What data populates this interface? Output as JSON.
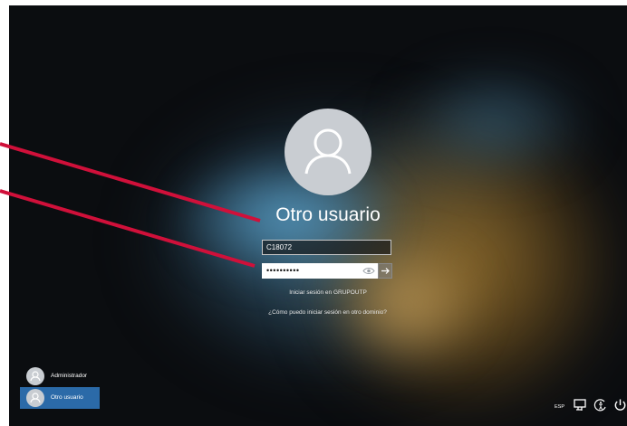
{
  "login": {
    "user_title": "Otro usuario",
    "username_value": "C18072",
    "password_mask": "••••••••••",
    "signin_domain_text": "Iniciar sesión en GRUPOUTP",
    "help_link": "¿Cómo puedo iniciar sesión en otro dominio?"
  },
  "user_list": [
    {
      "label": "Administrador",
      "selected": false
    },
    {
      "label": "Otro usuario",
      "selected": true
    }
  ],
  "tray": {
    "language": "ESP",
    "icons": [
      "network-icon",
      "ease-of-access-icon",
      "power-icon"
    ]
  },
  "colors": {
    "selected_user_bg": "#2b6aa8",
    "callout_line": "#d0103a",
    "avatar_bg": "#c9cdd2"
  }
}
